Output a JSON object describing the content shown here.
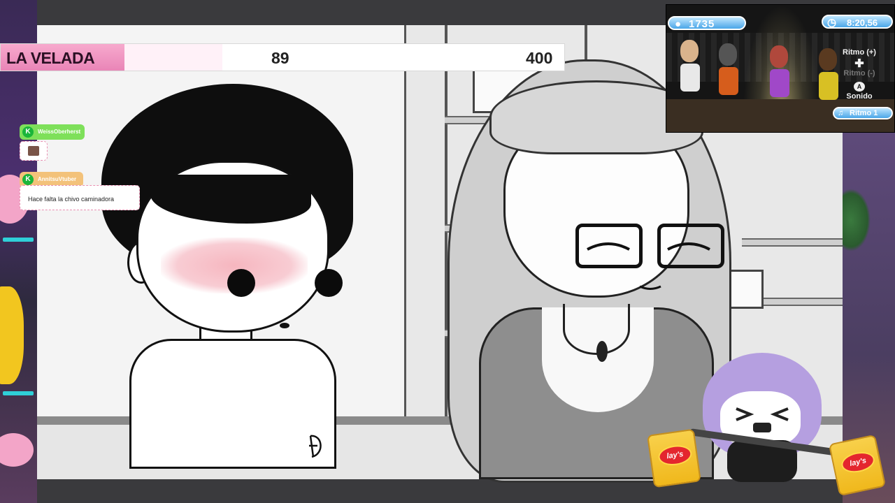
{
  "score_bar": {
    "label": "LA VELADA",
    "current": "89",
    "goal": "400",
    "progress_fraction": 0.2225
  },
  "chat": {
    "messages": [
      {
        "username": "WeissOberherst",
        "text": "",
        "name_color": "#7ee05a"
      },
      {
        "username": "AnnitsuVtuber",
        "text": "Hace falta la chivo caminadora",
        "name_color": "#f3c27a"
      }
    ]
  },
  "wii_game": {
    "score": "1735",
    "timer": "8:20,56",
    "controls": {
      "ritmo_plus": "Ritmo (+)",
      "ritmo_minus": "Ritmo (-)",
      "sonido": "Sonido",
      "ritmo_current": "Ritmo 1"
    }
  },
  "overlay": {
    "chips_brand": "lay's"
  },
  "colors": {
    "accent_pink": "#e985b7",
    "frame_dark": "#3a3a3d",
    "wii_blue": "#4aa6e8"
  }
}
